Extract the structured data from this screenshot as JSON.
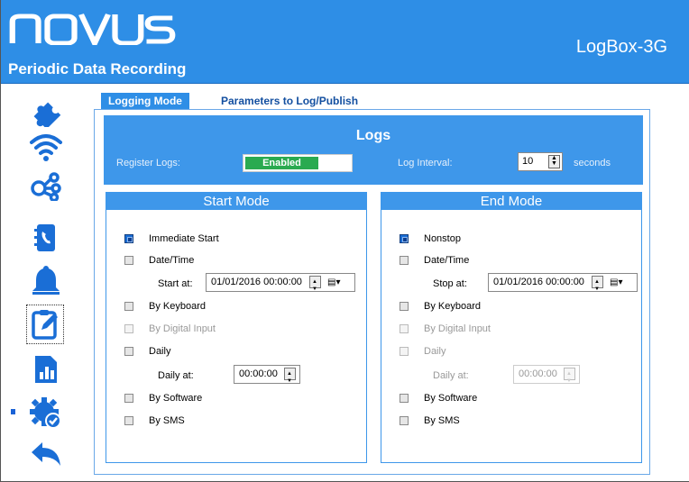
{
  "header": {
    "logo": "novus",
    "subtitle": "Periodic Data Recording",
    "model": "LogBox-3G"
  },
  "sidebar": {
    "items": [
      {
        "name": "puzzle-icon"
      },
      {
        "name": "wifi-icon"
      },
      {
        "name": "network-icon"
      },
      {
        "name": "phonebook-icon"
      },
      {
        "name": "bell-icon"
      },
      {
        "name": "clipboard-edit-icon",
        "selected": true
      },
      {
        "name": "chart-icon"
      },
      {
        "name": "gear-check-icon"
      },
      {
        "name": "back-arrow-icon"
      }
    ]
  },
  "tabs": [
    {
      "label": "Logging Mode",
      "active": true
    },
    {
      "label": "Parameters to Log/Publish",
      "active": false
    }
  ],
  "logs": {
    "title": "Logs",
    "register_label": "Register Logs:",
    "register_state": "Enabled",
    "interval_label": "Log Interval:",
    "interval_value": "10",
    "interval_unit": "seconds"
  },
  "start_mode": {
    "title": "Start Mode",
    "immediate": "Immediate Start",
    "datetime": "Date/Time",
    "start_at_label": "Start at:",
    "start_at_value": "01/01/2016  00:00:00",
    "keyboard": "By Keyboard",
    "digital": "By Digital Input",
    "daily": "Daily",
    "daily_at_label": "Daily at:",
    "daily_at_value": "00:00:00",
    "software": "By Software",
    "sms": "By SMS"
  },
  "end_mode": {
    "title": "End Mode",
    "nonstop": "Nonstop",
    "datetime": "Date/Time",
    "stop_at_label": "Stop at:",
    "stop_at_value": "01/01/2016  00:00:00",
    "keyboard": "By Keyboard",
    "digital": "By Digital Input",
    "daily": "Daily",
    "daily_at_label": "Daily at:",
    "daily_at_value": "00:00:00",
    "software": "By Software",
    "sms": "By SMS"
  },
  "colors": {
    "accent": "#2e8ee6",
    "enabled": "#2aaa50"
  }
}
